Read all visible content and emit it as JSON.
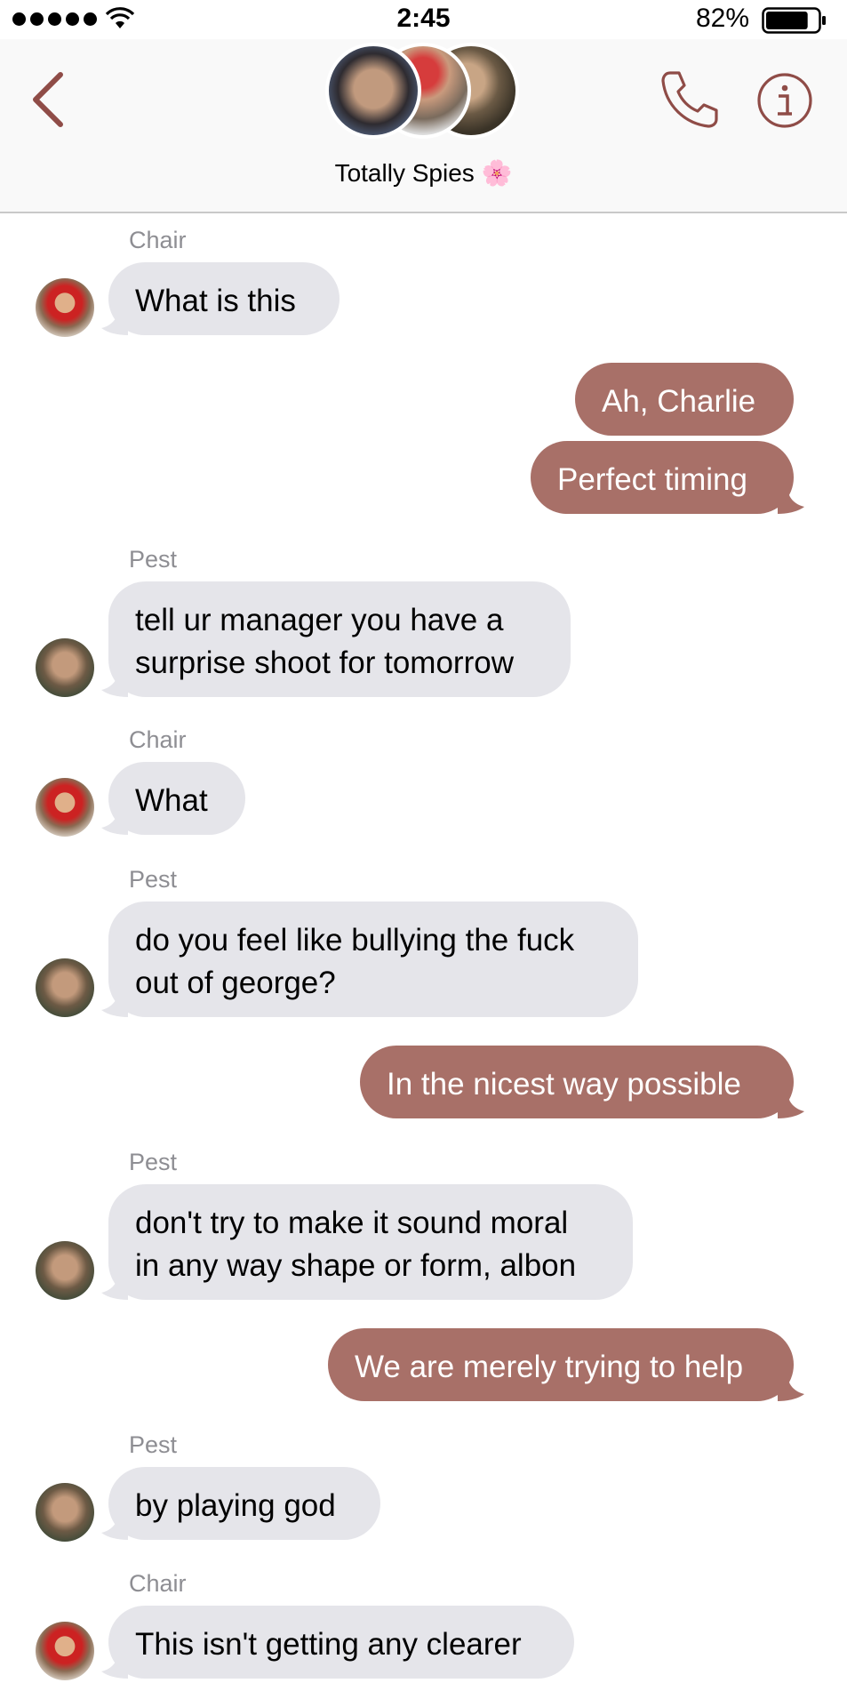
{
  "status_bar": {
    "time": "2:45",
    "battery_percent": "82%",
    "battery_level": 0.82,
    "signal_bars": 5,
    "wifi_icon": "wifi-icon"
  },
  "header": {
    "group_name": "Totally Spies",
    "group_emoji": "🌸",
    "accent_color": "#8f4c47"
  },
  "colors": {
    "incoming_bubble": "#e5e5ea",
    "outgoing_bubble": "#a87068",
    "sender_label": "#8e8e93"
  },
  "messages": [
    {
      "sender": "Chair",
      "direction": "in",
      "lines": [
        "What is this"
      ]
    },
    {
      "sender": "",
      "direction": "out",
      "lines": [
        "Ah, Charlie"
      ]
    },
    {
      "sender": "",
      "direction": "out",
      "lines": [
        "Perfect timing"
      ]
    },
    {
      "sender": "Pest",
      "direction": "in",
      "lines": [
        "tell ur manager you have a",
        "surprise shoot for tomorrow"
      ]
    },
    {
      "sender": "Chair",
      "direction": "in",
      "lines": [
        "What"
      ]
    },
    {
      "sender": "Pest",
      "direction": "in",
      "lines": [
        "do you feel like bullying the fuck",
        "out of george?"
      ]
    },
    {
      "sender": "",
      "direction": "out",
      "lines": [
        "In the nicest way possible"
      ]
    },
    {
      "sender": "Pest",
      "direction": "in",
      "lines": [
        "don't try to make it sound moral",
        "in any way shape or form, albon"
      ]
    },
    {
      "sender": "",
      "direction": "out",
      "lines": [
        "We are merely trying to help"
      ]
    },
    {
      "sender": "Pest",
      "direction": "in",
      "lines": [
        "by playing god"
      ]
    },
    {
      "sender": "Chair",
      "direction": "in",
      "lines": [
        "This isn't getting any clearer"
      ]
    }
  ]
}
